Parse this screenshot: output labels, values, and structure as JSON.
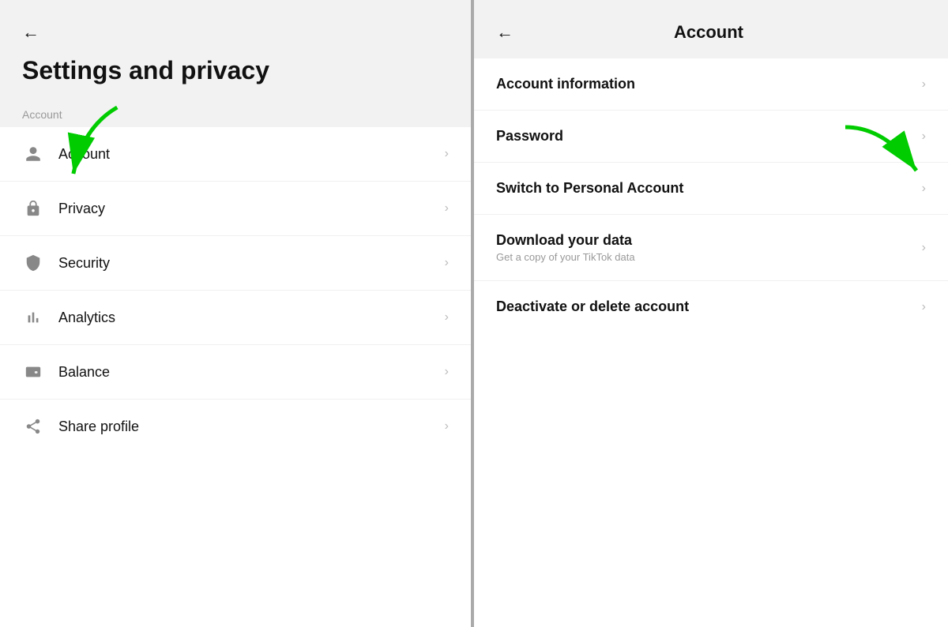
{
  "left": {
    "back_label": "←",
    "title": "Settings and privacy",
    "section_label": "Account",
    "menu_items": [
      {
        "id": "account",
        "label": "Account",
        "icon": "person"
      },
      {
        "id": "privacy",
        "label": "Privacy",
        "icon": "lock"
      },
      {
        "id": "security",
        "label": "Security",
        "icon": "shield"
      },
      {
        "id": "analytics",
        "label": "Analytics",
        "icon": "chart"
      },
      {
        "id": "balance",
        "label": "Balance",
        "icon": "wallet"
      },
      {
        "id": "share-profile",
        "label": "Share profile",
        "icon": "share"
      }
    ]
  },
  "right": {
    "back_label": "←",
    "title": "Account",
    "menu_items": [
      {
        "id": "account-information",
        "label": "Account information",
        "sublabel": ""
      },
      {
        "id": "password",
        "label": "Password",
        "sublabel": ""
      },
      {
        "id": "switch-personal",
        "label": "Switch to Personal Account",
        "sublabel": ""
      },
      {
        "id": "download-data",
        "label": "Download your data",
        "sublabel": "Get a copy of your TikTok data"
      },
      {
        "id": "deactivate",
        "label": "Deactivate or delete account",
        "sublabel": ""
      }
    ]
  },
  "icons": {
    "chevron": "›",
    "back": "←"
  }
}
